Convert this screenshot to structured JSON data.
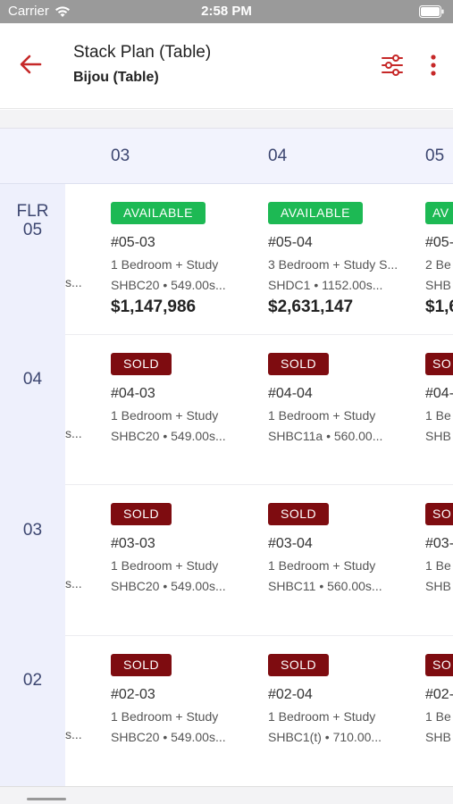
{
  "status_bar": {
    "carrier": "Carrier",
    "time": "2:58 PM"
  },
  "header": {
    "title": "Stack Plan (Table)",
    "subtitle": "Bijou (Table)"
  },
  "colors": {
    "accent": "#c62828",
    "available": "#1db954",
    "sold": "#7e0c10",
    "header_bg": "#f2f3fd"
  },
  "columns": [
    "03",
    "04",
    "05"
  ],
  "floors": [
    {
      "label": "FLR\n05",
      "cells": [
        {
          "status": "AVAILABLE",
          "unit": "#05-03",
          "type": "1 Bedroom + Study",
          "meta": "SHBC20  •  549.00s...",
          "price": "$1,147,986"
        },
        {
          "status": "AVAILABLE",
          "unit": "#05-04",
          "type": "3 Bedroom + Study S...",
          "meta": "SHDC1  •  1152.00s...",
          "price": "$2,631,147"
        },
        {
          "status": "AV",
          "unit": "#05-",
          "type": "2 Be",
          "meta": "SHB",
          "price": "$1,6"
        }
      ]
    },
    {
      "label": "04",
      "cells": [
        {
          "status": "SOLD",
          "unit": "#04-03",
          "type": "1 Bedroom + Study",
          "meta": "SHBC20  •  549.00s..."
        },
        {
          "status": "SOLD",
          "unit": "#04-04",
          "type": "1 Bedroom + Study",
          "meta": "SHBC11a  •  560.00..."
        },
        {
          "status": "SO",
          "unit": "#04-",
          "type": "1 Be",
          "meta": "SHB"
        }
      ]
    },
    {
      "label": "03",
      "cells": [
        {
          "status": "SOLD",
          "unit": "#03-03",
          "type": "1 Bedroom + Study",
          "meta": "SHBC20  •  549.00s..."
        },
        {
          "status": "SOLD",
          "unit": "#03-04",
          "type": "1 Bedroom + Study",
          "meta": "SHBC11  •  560.00s..."
        },
        {
          "status": "SO",
          "unit": "#03-",
          "type": "1 Be",
          "meta": "SHB"
        }
      ]
    },
    {
      "label": "02",
      "cells": [
        {
          "status": "SOLD",
          "unit": "#02-03",
          "type": "1 Bedroom + Study",
          "meta": "SHBC20  •  549.00s..."
        },
        {
          "status": "SOLD",
          "unit": "#02-04",
          "type": "1 Bedroom + Study",
          "meta": "SHBC1(t)  •  710.00..."
        },
        {
          "status": "SO",
          "unit": "#02-",
          "type": "1 Be",
          "meta": "SHB"
        }
      ]
    }
  ],
  "partial_left_text": "s..."
}
